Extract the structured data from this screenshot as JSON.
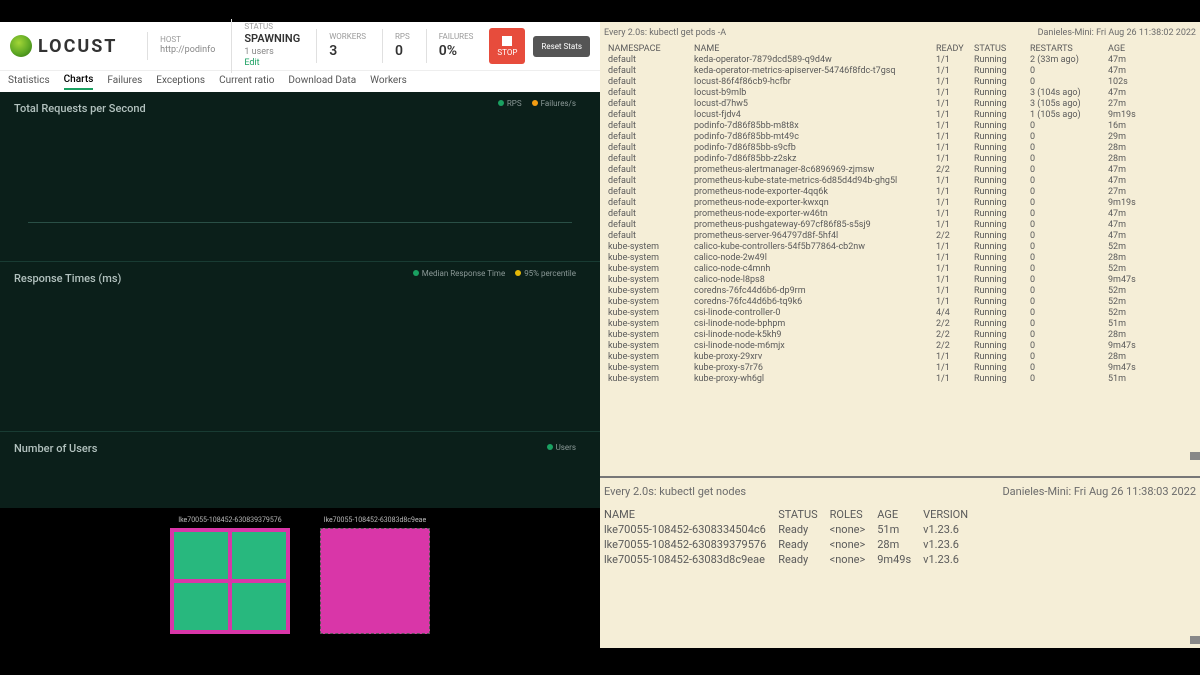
{
  "locust": {
    "brand": "LOCUST",
    "host_label": "HOST",
    "host": "http://podinfo",
    "status_label": "STATUS",
    "status": "SPAWNING",
    "users": "1 users",
    "edit": "Edit",
    "workers_label": "WORKERS",
    "workers": "3",
    "rps_label": "RPS",
    "rps": "0",
    "failures_label": "FAILURES",
    "failures": "0%",
    "stop": "STOP",
    "reset": "Reset Stats",
    "tabs": [
      "Statistics",
      "Charts",
      "Failures",
      "Exceptions",
      "Current ratio",
      "Download Data",
      "Workers"
    ],
    "charts": {
      "rps_title": "Total Requests per Second",
      "rps_legend": [
        "RPS",
        "Failures/s"
      ],
      "rt_title": "Response Times (ms)",
      "rt_legend": [
        "Median Response Time",
        "95% percentile"
      ],
      "users_title": "Number of Users",
      "users_legend": [
        "Users"
      ]
    },
    "thumbs": [
      "lke70055-108452-630839379576",
      "lke70055-108452-63083d8c9eae"
    ]
  },
  "term": {
    "watch1": "Every 2.0s: kubectl get pods -A",
    "host1": "Danieles-Mini: Fri Aug 26 11:38:02 2022",
    "pod_head": [
      "NAMESPACE",
      "NAME",
      "READY",
      "STATUS",
      "RESTARTS",
      "AGE"
    ],
    "pods": [
      [
        "default",
        "keda-operator-7879dcd589-q9d4w",
        "1/1",
        "Running",
        "2 (33m ago)",
        "47m"
      ],
      [
        "default",
        "keda-operator-metrics-apiserver-54746f8fdc-t7gsq",
        "1/1",
        "Running",
        "0",
        "47m"
      ],
      [
        "default",
        "locust-86f4f86cb9-hcfbr",
        "1/1",
        "Running",
        "0",
        "102s"
      ],
      [
        "default",
        "locust-b9mlb",
        "1/1",
        "Running",
        "3 (104s ago)",
        "47m"
      ],
      [
        "default",
        "locust-d7hw5",
        "1/1",
        "Running",
        "3 (105s ago)",
        "27m"
      ],
      [
        "default",
        "locust-fjdv4",
        "1/1",
        "Running",
        "1 (105s ago)",
        "9m19s"
      ],
      [
        "default",
        "podinfo-7d86f85bb-m8t8x",
        "1/1",
        "Running",
        "0",
        "16m"
      ],
      [
        "default",
        "podinfo-7d86f85bb-mt49c",
        "1/1",
        "Running",
        "0",
        "29m"
      ],
      [
        "default",
        "podinfo-7d86f85bb-s9cfb",
        "1/1",
        "Running",
        "0",
        "28m"
      ],
      [
        "default",
        "podinfo-7d86f85bb-z2skz",
        "1/1",
        "Running",
        "0",
        "28m"
      ],
      [
        "default",
        "prometheus-alertmanager-8c6896969-zjmsw",
        "2/2",
        "Running",
        "0",
        "47m"
      ],
      [
        "default",
        "prometheus-kube-state-metrics-6d85d4d94b-ghg5l",
        "1/1",
        "Running",
        "0",
        "47m"
      ],
      [
        "default",
        "prometheus-node-exporter-4qq6k",
        "1/1",
        "Running",
        "0",
        "27m"
      ],
      [
        "default",
        "prometheus-node-exporter-kwxqn",
        "1/1",
        "Running",
        "0",
        "9m19s"
      ],
      [
        "default",
        "prometheus-node-exporter-w46tn",
        "1/1",
        "Running",
        "0",
        "47m"
      ],
      [
        "default",
        "prometheus-pushgateway-697cf86f85-s5sj9",
        "1/1",
        "Running",
        "0",
        "47m"
      ],
      [
        "default",
        "prometheus-server-964797d8f-5hf4l",
        "2/2",
        "Running",
        "0",
        "47m"
      ],
      [
        "kube-system",
        "calico-kube-controllers-54f5b77864-cb2nw",
        "1/1",
        "Running",
        "0",
        "52m"
      ],
      [
        "kube-system",
        "calico-node-2w49l",
        "1/1",
        "Running",
        "0",
        "28m"
      ],
      [
        "kube-system",
        "calico-node-c4mnh",
        "1/1",
        "Running",
        "0",
        "52m"
      ],
      [
        "kube-system",
        "calico-node-l8ps8",
        "1/1",
        "Running",
        "0",
        "9m47s"
      ],
      [
        "kube-system",
        "coredns-76fc44d6b6-dp9rm",
        "1/1",
        "Running",
        "0",
        "52m"
      ],
      [
        "kube-system",
        "coredns-76fc44d6b6-tq9k6",
        "1/1",
        "Running",
        "0",
        "52m"
      ],
      [
        "kube-system",
        "csi-linode-controller-0",
        "4/4",
        "Running",
        "0",
        "52m"
      ],
      [
        "kube-system",
        "csi-linode-node-bphpm",
        "2/2",
        "Running",
        "0",
        "51m"
      ],
      [
        "kube-system",
        "csi-linode-node-k5kh9",
        "2/2",
        "Running",
        "0",
        "28m"
      ],
      [
        "kube-system",
        "csi-linode-node-m6mjx",
        "2/2",
        "Running",
        "0",
        "9m47s"
      ],
      [
        "kube-system",
        "kube-proxy-29xrv",
        "1/1",
        "Running",
        "0",
        "28m"
      ],
      [
        "kube-system",
        "kube-proxy-s7r76",
        "1/1",
        "Running",
        "0",
        "9m47s"
      ],
      [
        "kube-system",
        "kube-proxy-wh6gl",
        "1/1",
        "Running",
        "0",
        "51m"
      ]
    ],
    "watch2": "Every 2.0s: kubectl get nodes",
    "host2": "Danieles-Mini: Fri Aug 26 11:38:03 2022",
    "node_head": [
      "NAME",
      "STATUS",
      "ROLES",
      "AGE",
      "VERSION"
    ],
    "nodes": [
      [
        "lke70055-108452-6308334504c6",
        "Ready",
        "<none>",
        "51m",
        "v1.23.6"
      ],
      [
        "lke70055-108452-630839379576",
        "Ready",
        "<none>",
        "28m",
        "v1.23.6"
      ],
      [
        "lke70055-108452-63083d8c9eae",
        "Ready",
        "<none>",
        "9m49s",
        "v1.23.6"
      ]
    ]
  }
}
